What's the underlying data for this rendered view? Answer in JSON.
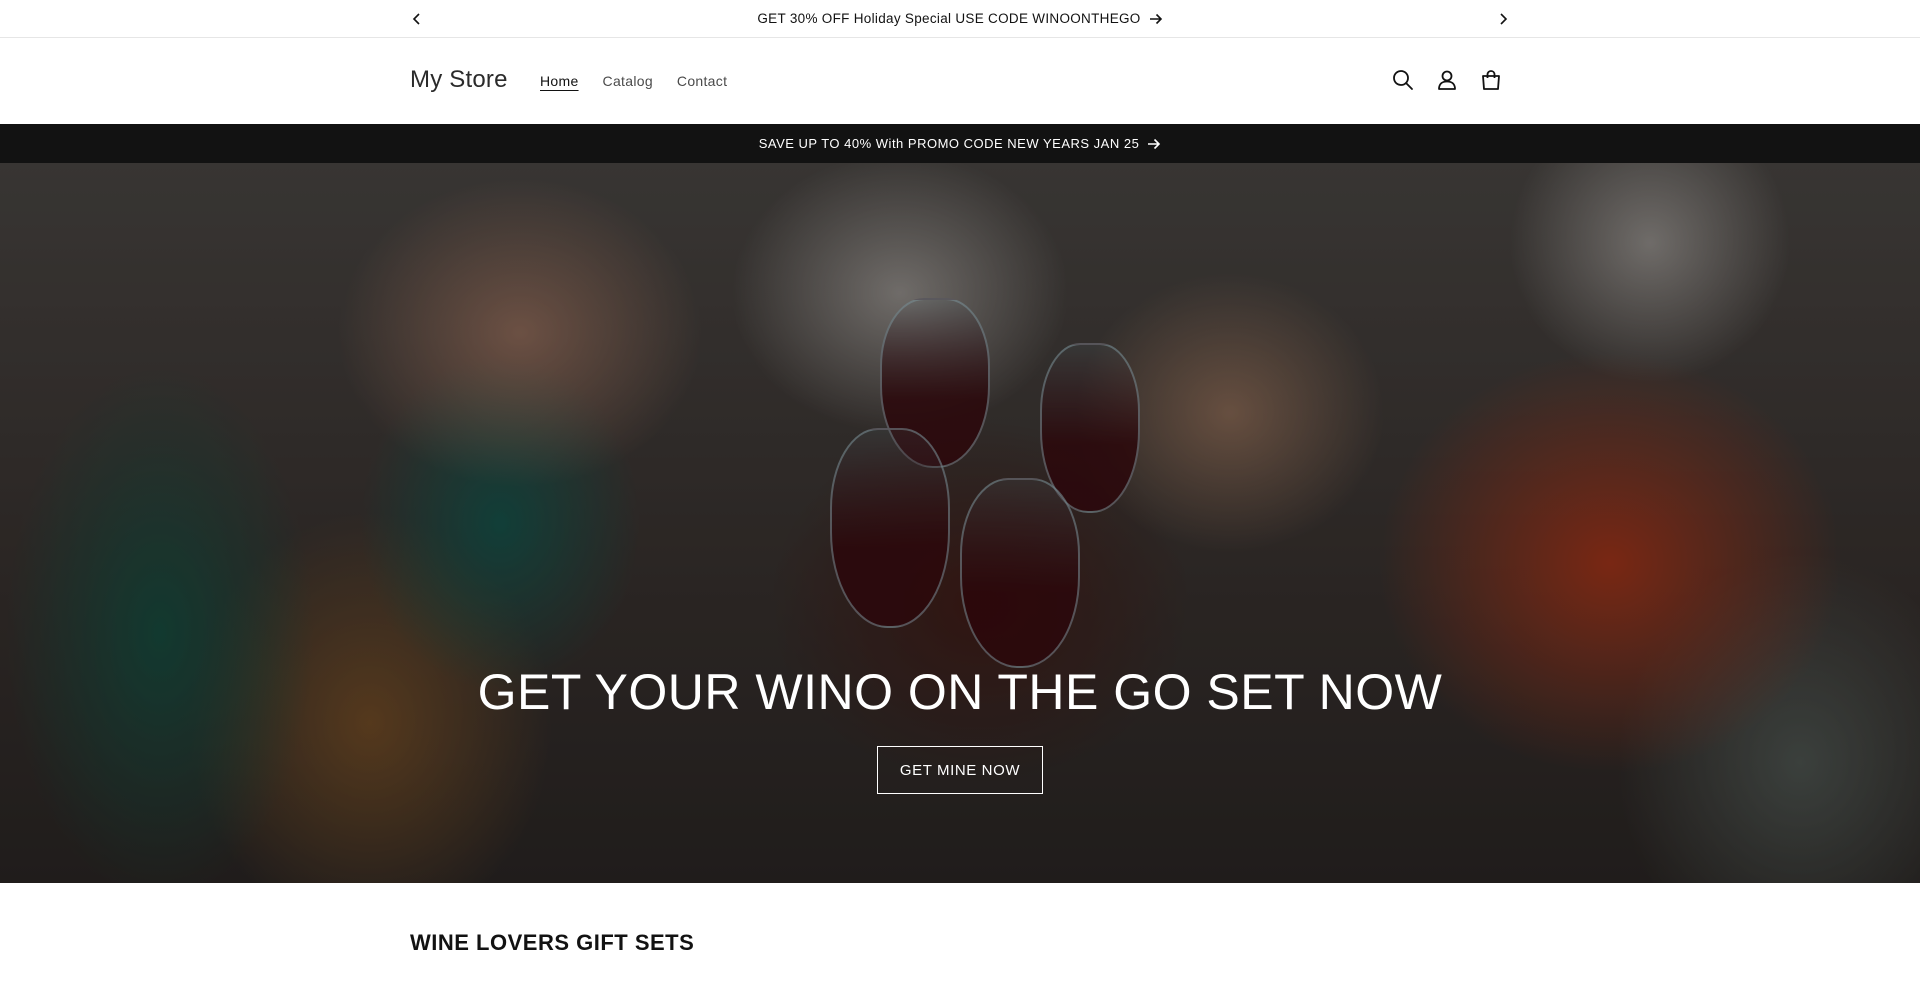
{
  "announcement": {
    "text": "GET 30% OFF Holiday Special USE CODE WINOONTHEGO"
  },
  "header": {
    "logo": "My Store",
    "nav": [
      {
        "label": "Home"
      },
      {
        "label": "Catalog"
      },
      {
        "label": "Contact"
      }
    ],
    "icons": [
      "search-icon",
      "account-icon",
      "cart-icon"
    ]
  },
  "promo": {
    "text": "SAVE UP TO 40% With PROMO CODE NEW YEARS JAN 25"
  },
  "hero": {
    "headline": "GET YOUR WINO ON THE GO SET NOW",
    "button_label": "GET MINE NOW"
  },
  "collection": {
    "title": "WINE LOVERS GIFT SETS"
  },
  "colors": {
    "promo_bar_bg": "#121212",
    "text": "#121212",
    "hero_text": "#ffffff"
  }
}
